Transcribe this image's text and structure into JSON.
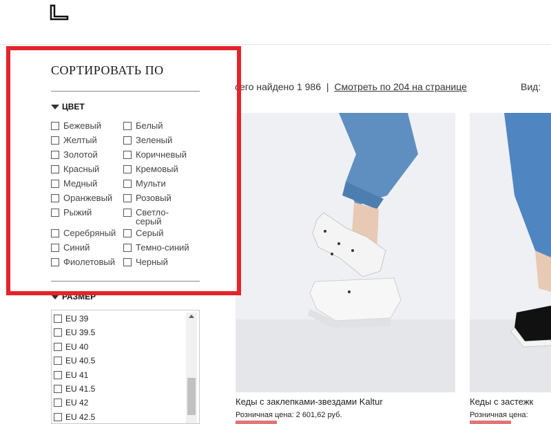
{
  "colors_theme": {
    "frame": "#e5232b",
    "text": "#222222"
  },
  "header": {
    "logo_icon": "brand-logo-icon"
  },
  "sidebar": {
    "sort_title": "СОРТИРОВАТЬ ПО",
    "color_facet": {
      "title": "ЦВЕТ",
      "options": [
        "Бежевый",
        "Белый",
        "Желтый",
        "Зеленый",
        "Золотой",
        "Коричневый",
        "Красный",
        "Кремовый",
        "Медный",
        "Мульти",
        "Оранжевый",
        "Розовый",
        "Рыжий",
        "Светло-\nсерый",
        "Серебряный",
        "Серый",
        "Синий",
        "Темно-синий",
        "Фиолетовый",
        "Черный"
      ]
    },
    "size_facet": {
      "title": "РАЗМЕР",
      "options": [
        "EU 39",
        "EU 39.5",
        "EU 40",
        "EU 40.5",
        "EU 41",
        "EU 41.5",
        "EU 42",
        "EU 42.5"
      ]
    }
  },
  "results_bar": {
    "found_text": "сего найдено 1 986",
    "separator": "|",
    "per_page_link": "Смотреть по 204 на странице",
    "view_label": "Вид:"
  },
  "products": [
    {
      "title": "Кеды с заклепками-звездами Kaltur",
      "price": "Розничная цена: 2 601,62 руб."
    },
    {
      "title": "Кеды с застежк",
      "price": "Розничная цена:"
    }
  ]
}
